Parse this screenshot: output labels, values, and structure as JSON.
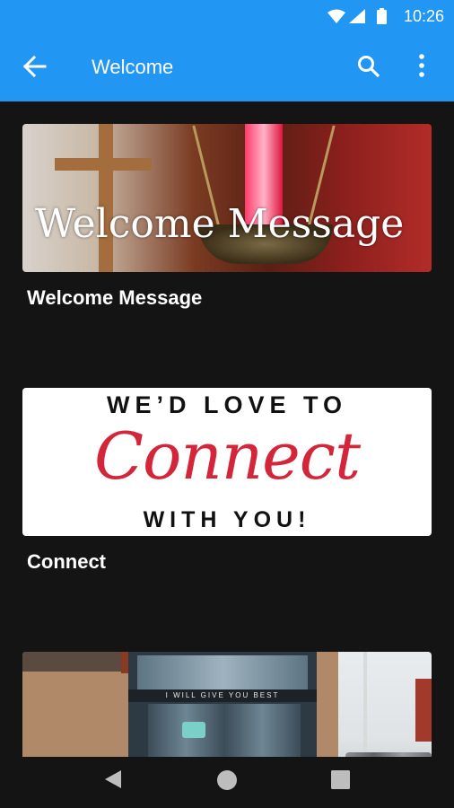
{
  "status_bar": {
    "time": "10:26"
  },
  "app_bar": {
    "title": "Welcome"
  },
  "cards": [
    {
      "title": "Welcome Message",
      "image_text": "Welcome Message"
    },
    {
      "title": "Connect",
      "image_text_top": "WE’D LOVE TO",
      "image_text_script": "Connect",
      "image_text_bottom": "WITH YOU!"
    },
    {
      "sign_text": "I WILL GIVE YOU BEST"
    }
  ],
  "colors": {
    "primary": "#2196f3",
    "background": "#141414",
    "accent_red": "#d4263a"
  },
  "icons": [
    "wifi-icon",
    "signal-icon",
    "battery-icon",
    "back-arrow-icon",
    "search-icon",
    "more-vert-icon",
    "nav-back-icon",
    "nav-home-icon",
    "nav-recents-icon"
  ]
}
